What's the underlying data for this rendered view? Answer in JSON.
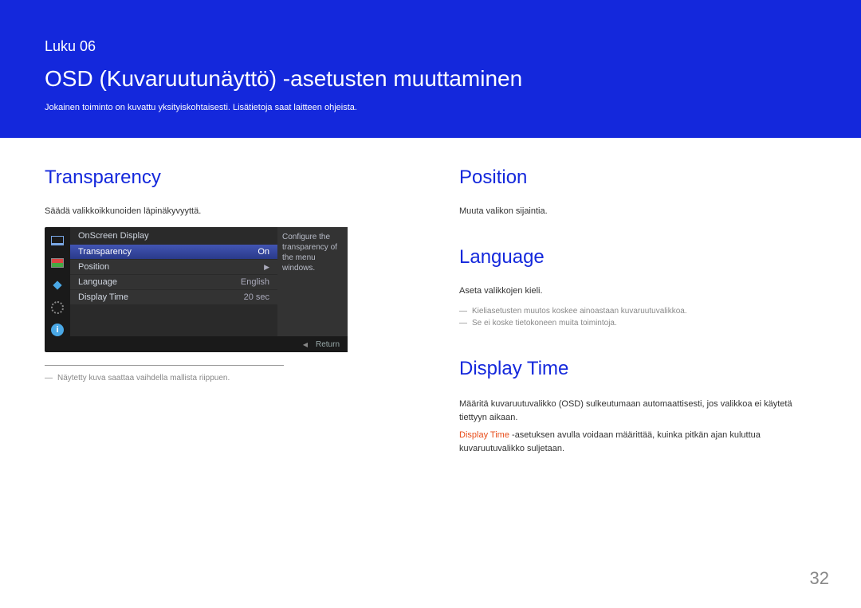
{
  "header": {
    "chapter_label": "Luku 06",
    "title": "OSD (Kuvaruutunäyttö) -asetusten muuttaminen",
    "subtitle": "Jokainen toiminto on kuvattu yksityiskohtaisesti. Lisätietoja saat laitteen ohjeista."
  },
  "left": {
    "transparency": {
      "title": "Transparency",
      "desc": "Säädä valikkoikkunoiden läpinäkyvyyttä."
    },
    "osd_menu": {
      "title": "OnScreen Display",
      "rows": [
        {
          "label": "Transparency",
          "value": "On",
          "selected": true
        },
        {
          "label": "Position",
          "value": "",
          "caret": true
        },
        {
          "label": "Language",
          "value": "English"
        },
        {
          "label": "Display Time",
          "value": "20 sec"
        }
      ],
      "help": "Configure the transparency of the menu windows.",
      "footer_return": "Return"
    },
    "footnote": "Näytetty kuva saattaa vaihdella mallista riippuen."
  },
  "right": {
    "position": {
      "title": "Position",
      "desc": "Muuta valikon sijaintia."
    },
    "language": {
      "title": "Language",
      "desc": "Aseta valikkojen kieli.",
      "note1": "Kieliasetusten muutos koskee ainoastaan kuvaruutuvalikkoa.",
      "note2": "Se ei koske tietokoneen muita toimintoja."
    },
    "display_time": {
      "title": "Display Time",
      "desc1": "Määritä kuvaruutuvalikko (OSD) sulkeutumaan automaattisesti, jos valikkoa ei käytetä tiettyyn aikaan.",
      "highlight": "Display Time",
      "desc2": " -asetuksen avulla voidaan määrittää, kuinka pitkän ajan kuluttua kuvaruutuvalikko suljetaan."
    }
  },
  "page_number": "32"
}
